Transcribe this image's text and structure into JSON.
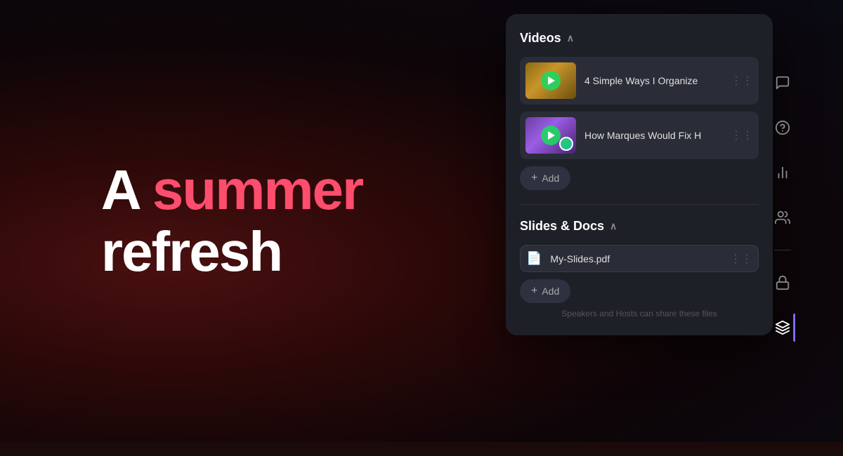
{
  "background": {
    "color": "#1a0a0a"
  },
  "hero": {
    "line1_prefix": "A ",
    "line1_accent": "summer",
    "line2": "refresh"
  },
  "panel": {
    "videos_section": {
      "title": "Videos",
      "items": [
        {
          "title": "4 Simple Ways I Organize",
          "full_title": "4 Simple Ways I Organize"
        },
        {
          "title": "How Marques Would Fix H",
          "full_title": "How Marques Would Fix H"
        }
      ],
      "add_button_label": "+ Add"
    },
    "slides_section": {
      "title": "Slides & Docs",
      "items": [
        {
          "title": "My-Slides.pdf"
        }
      ],
      "add_button_label": "+ Add",
      "hint": "Speakers and Hosts can share these files"
    }
  },
  "sidebar": {
    "icons": [
      {
        "name": "chat-icon",
        "symbol": "💬"
      },
      {
        "name": "help-icon",
        "symbol": "❓"
      },
      {
        "name": "chart-icon",
        "symbol": "📊"
      },
      {
        "name": "people-icon",
        "symbol": "👥"
      },
      {
        "name": "lock-icon",
        "symbol": "🔒"
      },
      {
        "name": "layers-icon",
        "symbol": "⊞"
      }
    ]
  }
}
